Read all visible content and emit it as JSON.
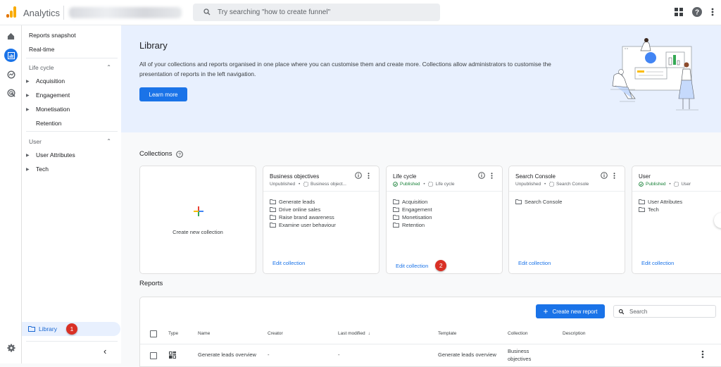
{
  "topbar": {
    "app_title": "Analytics",
    "search_placeholder": "Try searching \"how to create funnel\"",
    "icons": [
      "apps-grid-icon",
      "help-icon",
      "more-vert-icon"
    ]
  },
  "rail": {
    "items": [
      "home-icon",
      "reports-icon",
      "explore-icon",
      "advertising-icon"
    ],
    "active": "reports-icon",
    "bottom": "settings-icon"
  },
  "sidenav": {
    "top_items": [
      "Reports snapshot",
      "Real-time"
    ],
    "sections": [
      {
        "title": "Life cycle",
        "items": [
          {
            "label": "Acquisition",
            "expandable": true
          },
          {
            "label": "Engagement",
            "expandable": true
          },
          {
            "label": "Monetisation",
            "expandable": true
          },
          {
            "label": "Retention",
            "expandable": false
          }
        ]
      },
      {
        "title": "User",
        "items": [
          {
            "label": "User Attributes",
            "expandable": true
          },
          {
            "label": "Tech",
            "expandable": true
          }
        ]
      }
    ],
    "library_label": "Library",
    "library_badge": "1",
    "collapse_icon": "chevron-left-icon"
  },
  "hero": {
    "title": "Library",
    "description": "All of your collections and reports organised in one place where you can customise them and create more. Collections allow administrators to customise the presentation of reports in the left navigation.",
    "learn_more": "Learn more"
  },
  "collections": {
    "title": "Collections",
    "create_label": "Create new collection",
    "cards": [
      {
        "title": "Business objectives",
        "status": "Unpublished",
        "published": false,
        "template": "Business object...",
        "items": [
          "Generate leads",
          "Drive online sales",
          "Raise brand awareness",
          "Examine user behaviour"
        ],
        "edit": "Edit collection"
      },
      {
        "title": "Life cycle",
        "status": "Published",
        "published": true,
        "template": "Life cycle",
        "items": [
          "Acquisition",
          "Engagement",
          "Monetisation",
          "Retention"
        ],
        "edit": "Edit collection",
        "badge": "2"
      },
      {
        "title": "Search Console",
        "status": "Unpublished",
        "published": false,
        "template": "Search Console",
        "items": [
          "Search Console"
        ],
        "edit": "Edit collection"
      },
      {
        "title": "User",
        "status": "Published",
        "published": true,
        "template": "User",
        "items": [
          "User Attributes",
          "Tech"
        ],
        "edit": "Edit collection"
      }
    ]
  },
  "reports": {
    "title": "Reports",
    "create_button": "Create new report",
    "search_placeholder": "Search",
    "columns": [
      "Type",
      "Name",
      "Creator",
      "Last modified",
      "Template",
      "Collection",
      "Description"
    ],
    "sort_column": "Last modified",
    "rows": [
      {
        "type": "overview-icon",
        "name": "Generate leads overview",
        "creator": "-",
        "last_modified": "-",
        "template": "Generate leads overview",
        "collection": "Business objectives",
        "description": ""
      }
    ]
  },
  "colors": {
    "accent": "#1a73e8",
    "badge": "#d93025",
    "published": "#188038",
    "hero_bg": "#e8f0fe"
  }
}
